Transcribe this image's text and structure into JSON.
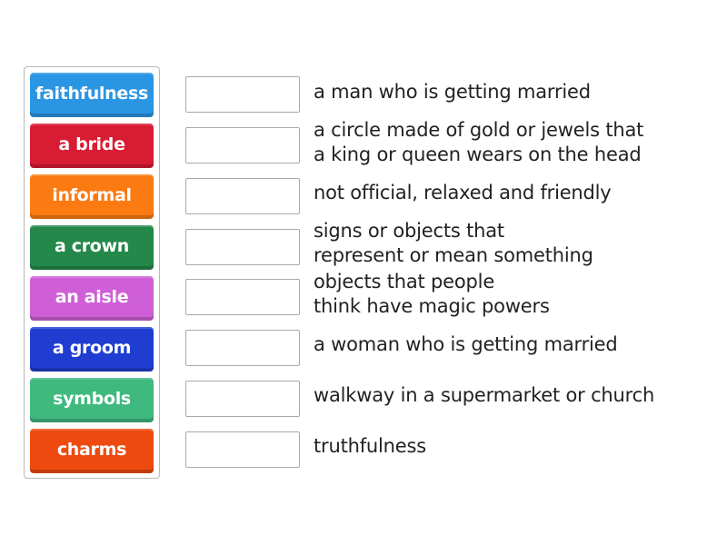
{
  "terms": [
    {
      "label": "faithfulness",
      "color": "#2a95e2"
    },
    {
      "label": "a bride",
      "color": "#d81c33"
    },
    {
      "label": "informal",
      "color": "#fb7a12"
    },
    {
      "label": "a crown",
      "color": "#23884a"
    },
    {
      "label": "an aisle",
      "color": "#cf5fd6"
    },
    {
      "label": "a groom",
      "color": "#1f3dd1"
    },
    {
      "label": "symbols",
      "color": "#3fb97e"
    },
    {
      "label": "charms",
      "color": "#ee4a0f"
    }
  ],
  "definitions": [
    {
      "text": "a man who is getting married"
    },
    {
      "text": "a circle made of gold or jewels that\na king or queen wears on the head"
    },
    {
      "text": "not official, relaxed and friendly"
    },
    {
      "text": "signs or objects that\nrepresent or mean something"
    },
    {
      "text": "objects that people\nthink have magic powers"
    },
    {
      "text": "a woman who is getting married"
    },
    {
      "text": "walkway in a supermarket or church"
    },
    {
      "text": "truthfulness"
    }
  ],
  "answers": [
    "",
    "",
    "",
    "",
    "",
    "",
    "",
    ""
  ]
}
